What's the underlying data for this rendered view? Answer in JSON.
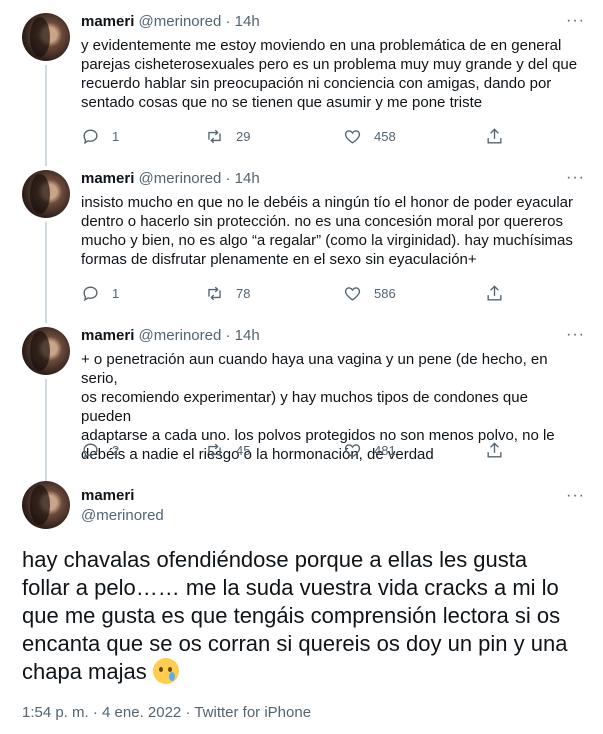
{
  "tweets": [
    {
      "name": "mameri",
      "handle": "@merinored",
      "time": "14h",
      "text": "y evidentemente me estoy moviendo en una problemática de en general\nparejas cisheterosexuales pero es un problema muy muy grande y del que\nrecuerdo hablar sin preocupación ni conciencia con amigas, dando por\nsentado cosas que no se tienen que asumir y me pone triste",
      "replies": "1",
      "retweets": "29",
      "likes": "458"
    },
    {
      "name": "mameri",
      "handle": "@merinored",
      "time": "14h",
      "text": "insisto mucho en que no le debéis a ningún tío el honor de poder eyacular\ndentro o hacerlo sin protección. no es una concesión moral por quereros\nmucho y bien, no es algo “a regalar” (como la virginidad). hay muchísimas\nformas de disfrutar plenamente en el sexo sin eyaculación+",
      "replies": "1",
      "retweets": "78",
      "likes": "586"
    },
    {
      "name": "mameri",
      "handle": "@merinored",
      "time": "14h",
      "text": "+ o penetración aun cuando haya una vagina y un pene (de hecho, en serio,\nos recomiendo experimentar) y hay muchos tipos de condones que pueden\nadaptarse a cada uno. los polvos protegidos no son menos polvo, no le\ndebéis a nadie el riesgo o la hormonación, de verdad",
      "replies": "2",
      "retweets": "45",
      "likes": "481"
    }
  ],
  "main": {
    "name": "mameri",
    "handle": "@merinored",
    "text": "hay chavalas ofendiéndose porque a ellas les gusta\nfollar a pelo…… me la suda vuestra vida cracks a mi lo\nque me gusta es que tengáis comprensión lectora si os\nencanta que se os corran si quereis os doy un pin y una\nchapa majas",
    "emoji": "face-holding-back-tears",
    "timestamp": "1:54 p. m. · 4 ene. 2022 · Twitter for iPhone"
  },
  "separator": "·",
  "more_glyph": "···"
}
